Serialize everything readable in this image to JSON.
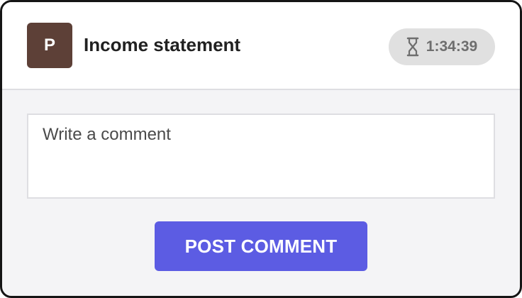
{
  "header": {
    "avatar_letter": "P",
    "avatar_color": "#5d4037",
    "title": "Income statement",
    "timer": {
      "icon": "hourglass-icon",
      "value": "1:34:39"
    }
  },
  "comment": {
    "placeholder": "Write a comment",
    "value": ""
  },
  "actions": {
    "post_label": "POST COMMENT",
    "post_color": "#5c5ce3"
  }
}
